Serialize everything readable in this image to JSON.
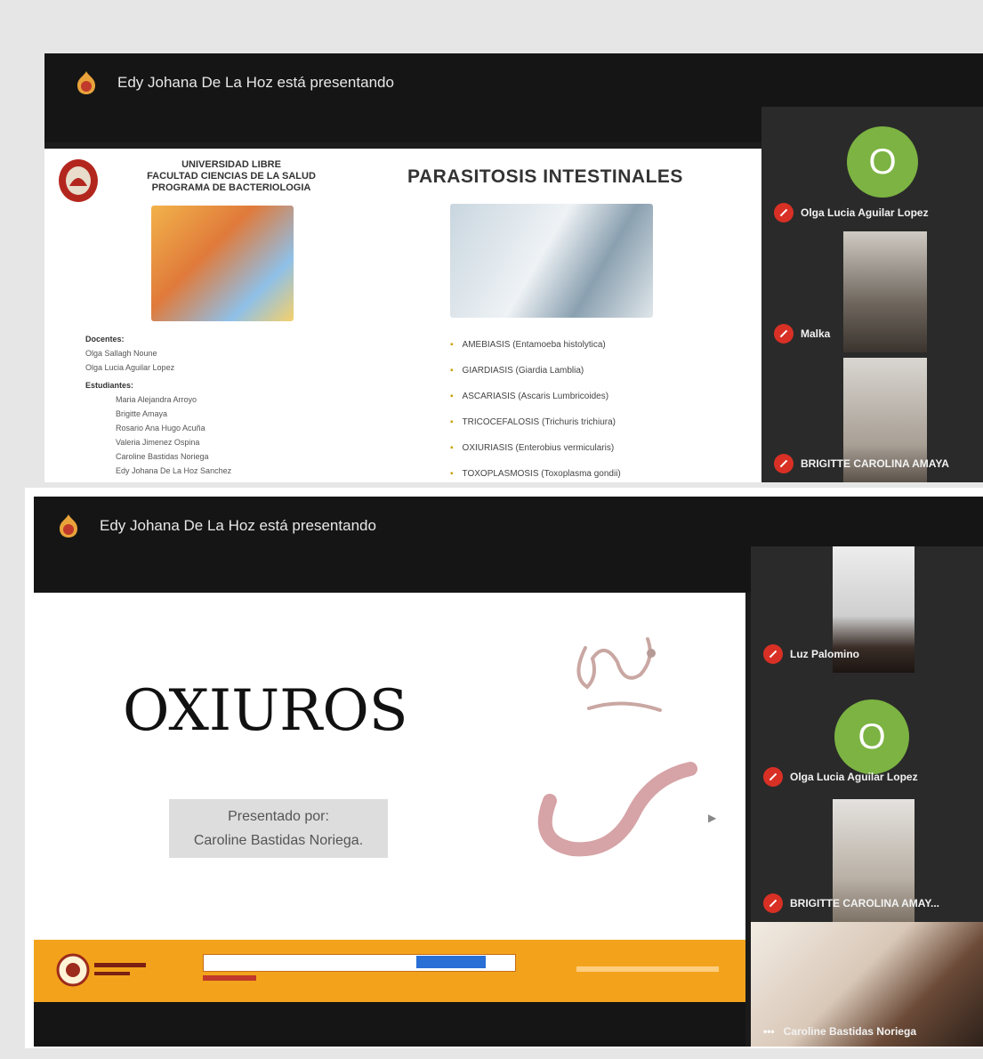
{
  "screenshot1": {
    "presenter_text": "Edy Johana De La Hoz está presentando",
    "slide": {
      "university_lines": [
        "UNIVERSIDAD LIBRE",
        "FACULTAD CIENCIAS DE LA SALUD",
        "PROGRAMA DE BACTERIOLOGIA"
      ],
      "title": "PARASITOSIS INTESTINALES",
      "docentes_label": "Docentes:",
      "docentes": [
        "Olga Sallagh Noune",
        "Olga Lucia Aguilar Lopez"
      ],
      "estudiantes_label": "Estudiantes:",
      "estudiantes": [
        "Maria Alejandra Arroyo",
        "Brigitte Amaya",
        "Rosario Ana Hugo Acuña",
        "Valeria Jimenez Ospina",
        "Caroline Bastidas Noriega",
        "Edy Johana De La Hoz Sanchez"
      ],
      "bullets": [
        "AMEBIASIS (Entamoeba histolytica)",
        "GIARDIASIS (Giardia Lamblia)",
        "ASCARIASIS (Ascaris Lumbricoides)",
        "TRICOCEFALOSIS (Trichuris trichiura)",
        "OXIURIASIS (Enterobius vermicularis)",
        "TOXOPLASMOSIS (Toxoplasma gondii)"
      ]
    },
    "participants": [
      {
        "name": "Olga Lucia Aguilar Lopez",
        "avatar_letter": "O",
        "avatar_color": "#7cb342"
      },
      {
        "name": "Malka"
      },
      {
        "name": "BRIGITTE CAROLINA AMAYA"
      }
    ]
  },
  "screenshot2": {
    "presenter_text": "Edy Johana De La Hoz está presentando",
    "slide": {
      "title": "OXIUROS",
      "presented_by": "Presentado por:",
      "presenter_name": "Caroline Bastidas Noriega."
    },
    "participants": [
      {
        "name": "Luz Palomino"
      },
      {
        "name": "Olga Lucia Aguilar Lopez",
        "avatar_letter": "O",
        "avatar_color": "#7cb342"
      },
      {
        "name": "BRIGITTE CAROLINA AMAY..."
      },
      {
        "name": "Caroline Bastidas Noriega"
      }
    ]
  },
  "colors": {
    "mic_off": "#d93025",
    "banner": "#f3a31b",
    "avatar": "#7cb342"
  }
}
